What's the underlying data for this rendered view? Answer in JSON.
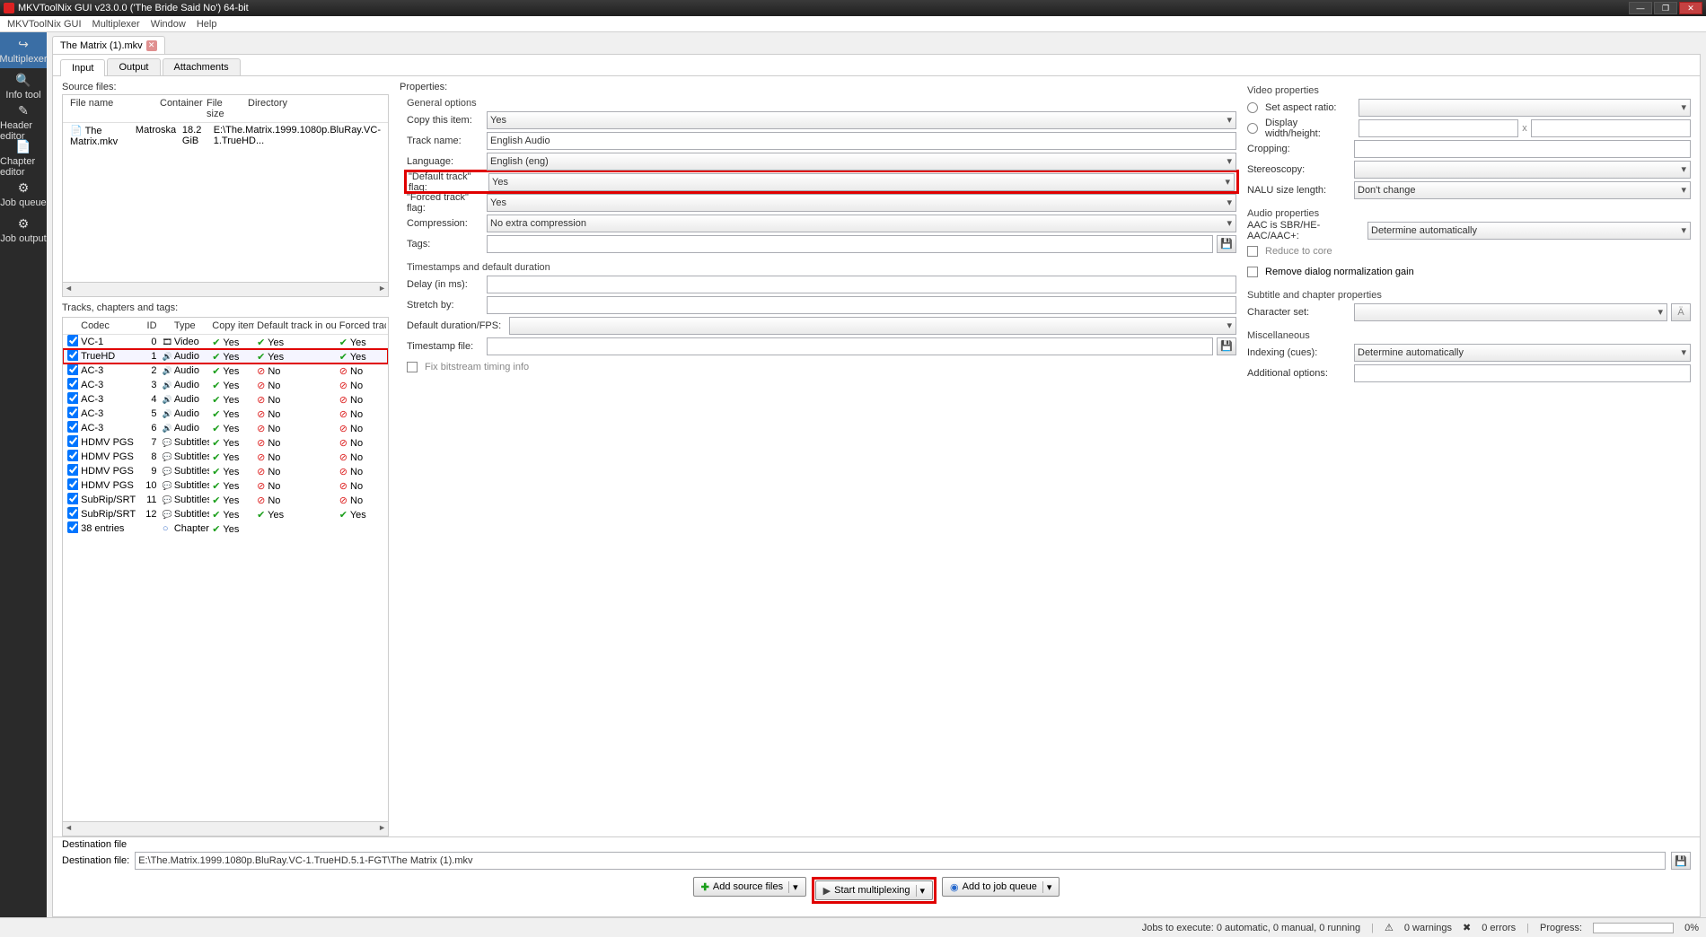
{
  "window": {
    "title": "MKVToolNix GUI v23.0.0 ('The Bride Said No') 64-bit"
  },
  "menubar": [
    "MKVToolNix GUI",
    "Multiplexer",
    "Window",
    "Help"
  ],
  "sidebar": [
    {
      "label": "Multiplexer",
      "icon": "↪",
      "active": true
    },
    {
      "label": "Info tool",
      "icon": "🔍"
    },
    {
      "label": "Header editor",
      "icon": "✎"
    },
    {
      "label": "Chapter editor",
      "icon": "📄"
    },
    {
      "label": "Job queue",
      "icon": "⚙"
    },
    {
      "label": "Job output",
      "icon": "⚙"
    }
  ],
  "filetab": {
    "name": "The Matrix (1).mkv"
  },
  "subtabs": [
    "Input",
    "Output",
    "Attachments"
  ],
  "source": {
    "label": "Source files:",
    "headers": {
      "file": "File name",
      "container": "Container",
      "size": "File size",
      "dir": "Directory"
    },
    "rows": [
      {
        "file": "The Matrix.mkv",
        "container": "Matroska",
        "size": "18.2 GiB",
        "dir": "E:\\The.Matrix.1999.1080p.BluRay.VC-1.TrueHD..."
      }
    ]
  },
  "tracks": {
    "label": "Tracks, chapters and tags:",
    "headers": {
      "codec": "Codec",
      "id": "ID",
      "type": "Type",
      "copy": "Copy item",
      "def": "Default track in output",
      "forced": "Forced trac"
    },
    "rows": [
      {
        "codec": "VC-1",
        "id": "0",
        "type": "Video",
        "ti": "film",
        "copy": "Yes",
        "def": "Yes",
        "forced": "Yes",
        "hl": false
      },
      {
        "codec": "TrueHD",
        "id": "1",
        "type": "Audio",
        "ti": "audio",
        "copy": "Yes",
        "def": "Yes",
        "forced": "Yes",
        "hl": true
      },
      {
        "codec": "AC-3",
        "id": "2",
        "type": "Audio",
        "ti": "audio",
        "copy": "Yes",
        "def": "No",
        "forced": "No"
      },
      {
        "codec": "AC-3",
        "id": "3",
        "type": "Audio",
        "ti": "audio",
        "copy": "Yes",
        "def": "No",
        "forced": "No"
      },
      {
        "codec": "AC-3",
        "id": "4",
        "type": "Audio",
        "ti": "audio",
        "copy": "Yes",
        "def": "No",
        "forced": "No"
      },
      {
        "codec": "AC-3",
        "id": "5",
        "type": "Audio",
        "ti": "audio",
        "copy": "Yes",
        "def": "No",
        "forced": "No"
      },
      {
        "codec": "AC-3",
        "id": "6",
        "type": "Audio",
        "ti": "audio",
        "copy": "Yes",
        "def": "No",
        "forced": "No"
      },
      {
        "codec": "HDMV PGS",
        "id": "7",
        "type": "Subtitles",
        "ti": "sub",
        "copy": "Yes",
        "def": "No",
        "forced": "No"
      },
      {
        "codec": "HDMV PGS",
        "id": "8",
        "type": "Subtitles",
        "ti": "sub",
        "copy": "Yes",
        "def": "No",
        "forced": "No"
      },
      {
        "codec": "HDMV PGS",
        "id": "9",
        "type": "Subtitles",
        "ti": "sub",
        "copy": "Yes",
        "def": "No",
        "forced": "No"
      },
      {
        "codec": "HDMV PGS",
        "id": "10",
        "type": "Subtitles",
        "ti": "sub",
        "copy": "Yes",
        "def": "No",
        "forced": "No"
      },
      {
        "codec": "SubRip/SRT",
        "id": "11",
        "type": "Subtitles",
        "ti": "sub",
        "copy": "Yes",
        "def": "No",
        "forced": "No"
      },
      {
        "codec": "SubRip/SRT",
        "id": "12",
        "type": "Subtitles",
        "ti": "sub",
        "copy": "Yes",
        "def": "Yes",
        "forced": "Yes"
      },
      {
        "codec": "38 entries",
        "id": "",
        "type": "Chapters",
        "ti": "chap",
        "copy": "Yes",
        "def": "",
        "forced": ""
      }
    ]
  },
  "props": {
    "title": "Properties:",
    "general": {
      "title": "General options",
      "copy_label": "Copy this item:",
      "copy_val": "Yes",
      "name_label": "Track name:",
      "name_val": "English Audio",
      "lang_label": "Language:",
      "lang_val": "English (eng)",
      "def_label": "\"Default track\" flag:",
      "def_val": "Yes",
      "forced_label": "\"Forced track\" flag:",
      "forced_val": "Yes",
      "comp_label": "Compression:",
      "comp_val": "No extra compression",
      "tags_label": "Tags:"
    },
    "ts": {
      "title": "Timestamps and default duration",
      "delay_label": "Delay (in ms):",
      "stretch_label": "Stretch by:",
      "fps_label": "Default duration/FPS:",
      "tsfile_label": "Timestamp file:",
      "fix_label": "Fix bitstream timing info"
    },
    "video": {
      "title": "Video properties",
      "aspect_label": "Set aspect ratio:",
      "dwh_label": "Display width/height:",
      "x": "x",
      "crop_label": "Cropping:",
      "stereo_label": "Stereoscopy:",
      "nalu_label": "NALU size length:",
      "nalu_val": "Don't change"
    },
    "audio": {
      "title": "Audio properties",
      "aac_label": "AAC is SBR/HE-AAC/AAC+:",
      "aac_val": "Determine automatically",
      "reduce_label": "Reduce to core",
      "norm_label": "Remove dialog normalization gain"
    },
    "sub": {
      "title": "Subtitle and chapter properties",
      "charset_label": "Character set:"
    },
    "misc": {
      "title": "Miscellaneous",
      "idx_label": "Indexing (cues):",
      "idx_val": "Determine automatically",
      "addl_label": "Additional options:"
    }
  },
  "dest": {
    "title": "Destination file",
    "label": "Destination file:",
    "value": "E:\\The.Matrix.1999.1080p.BluRay.VC-1.TrueHD.5.1-FGT\\The Matrix (1).mkv"
  },
  "buttons": {
    "add": "Add source files",
    "start": "Start multiplexing",
    "queue": "Add to job queue"
  },
  "status": {
    "jobs": "Jobs to execute:  0 automatic, 0 manual, 0 running",
    "warn": "0 warnings",
    "err": "0 errors",
    "prog_label": "Progress:",
    "prog_pct": "0%"
  }
}
